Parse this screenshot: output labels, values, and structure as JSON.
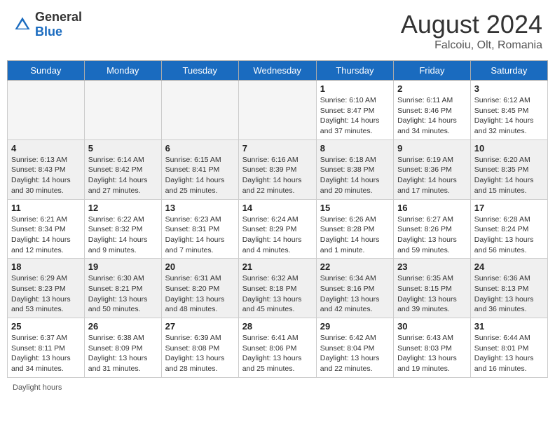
{
  "header": {
    "logo_general": "General",
    "logo_blue": "Blue",
    "month_year": "August 2024",
    "location": "Falcoiu, Olt, Romania"
  },
  "days_of_week": [
    "Sunday",
    "Monday",
    "Tuesday",
    "Wednesday",
    "Thursday",
    "Friday",
    "Saturday"
  ],
  "footer_text": "Daylight hours",
  "weeks": [
    [
      {
        "day": "",
        "empty": true
      },
      {
        "day": "",
        "empty": true
      },
      {
        "day": "",
        "empty": true
      },
      {
        "day": "",
        "empty": true
      },
      {
        "day": "1",
        "sunrise": "6:10 AM",
        "sunset": "8:47 PM",
        "daylight": "14 hours and 37 minutes."
      },
      {
        "day": "2",
        "sunrise": "6:11 AM",
        "sunset": "8:46 PM",
        "daylight": "14 hours and 34 minutes."
      },
      {
        "day": "3",
        "sunrise": "6:12 AM",
        "sunset": "8:45 PM",
        "daylight": "14 hours and 32 minutes."
      }
    ],
    [
      {
        "day": "4",
        "sunrise": "6:13 AM",
        "sunset": "8:43 PM",
        "daylight": "14 hours and 30 minutes."
      },
      {
        "day": "5",
        "sunrise": "6:14 AM",
        "sunset": "8:42 PM",
        "daylight": "14 hours and 27 minutes."
      },
      {
        "day": "6",
        "sunrise": "6:15 AM",
        "sunset": "8:41 PM",
        "daylight": "14 hours and 25 minutes."
      },
      {
        "day": "7",
        "sunrise": "6:16 AM",
        "sunset": "8:39 PM",
        "daylight": "14 hours and 22 minutes."
      },
      {
        "day": "8",
        "sunrise": "6:18 AM",
        "sunset": "8:38 PM",
        "daylight": "14 hours and 20 minutes."
      },
      {
        "day": "9",
        "sunrise": "6:19 AM",
        "sunset": "8:36 PM",
        "daylight": "14 hours and 17 minutes."
      },
      {
        "day": "10",
        "sunrise": "6:20 AM",
        "sunset": "8:35 PM",
        "daylight": "14 hours and 15 minutes."
      }
    ],
    [
      {
        "day": "11",
        "sunrise": "6:21 AM",
        "sunset": "8:34 PM",
        "daylight": "14 hours and 12 minutes."
      },
      {
        "day": "12",
        "sunrise": "6:22 AM",
        "sunset": "8:32 PM",
        "daylight": "14 hours and 9 minutes."
      },
      {
        "day": "13",
        "sunrise": "6:23 AM",
        "sunset": "8:31 PM",
        "daylight": "14 hours and 7 minutes."
      },
      {
        "day": "14",
        "sunrise": "6:24 AM",
        "sunset": "8:29 PM",
        "daylight": "14 hours and 4 minutes."
      },
      {
        "day": "15",
        "sunrise": "6:26 AM",
        "sunset": "8:28 PM",
        "daylight": "14 hours and 1 minute."
      },
      {
        "day": "16",
        "sunrise": "6:27 AM",
        "sunset": "8:26 PM",
        "daylight": "13 hours and 59 minutes."
      },
      {
        "day": "17",
        "sunrise": "6:28 AM",
        "sunset": "8:24 PM",
        "daylight": "13 hours and 56 minutes."
      }
    ],
    [
      {
        "day": "18",
        "sunrise": "6:29 AM",
        "sunset": "8:23 PM",
        "daylight": "13 hours and 53 minutes."
      },
      {
        "day": "19",
        "sunrise": "6:30 AM",
        "sunset": "8:21 PM",
        "daylight": "13 hours and 50 minutes."
      },
      {
        "day": "20",
        "sunrise": "6:31 AM",
        "sunset": "8:20 PM",
        "daylight": "13 hours and 48 minutes."
      },
      {
        "day": "21",
        "sunrise": "6:32 AM",
        "sunset": "8:18 PM",
        "daylight": "13 hours and 45 minutes."
      },
      {
        "day": "22",
        "sunrise": "6:34 AM",
        "sunset": "8:16 PM",
        "daylight": "13 hours and 42 minutes."
      },
      {
        "day": "23",
        "sunrise": "6:35 AM",
        "sunset": "8:15 PM",
        "daylight": "13 hours and 39 minutes."
      },
      {
        "day": "24",
        "sunrise": "6:36 AM",
        "sunset": "8:13 PM",
        "daylight": "13 hours and 36 minutes."
      }
    ],
    [
      {
        "day": "25",
        "sunrise": "6:37 AM",
        "sunset": "8:11 PM",
        "daylight": "13 hours and 34 minutes."
      },
      {
        "day": "26",
        "sunrise": "6:38 AM",
        "sunset": "8:09 PM",
        "daylight": "13 hours and 31 minutes."
      },
      {
        "day": "27",
        "sunrise": "6:39 AM",
        "sunset": "8:08 PM",
        "daylight": "13 hours and 28 minutes."
      },
      {
        "day": "28",
        "sunrise": "6:41 AM",
        "sunset": "8:06 PM",
        "daylight": "13 hours and 25 minutes."
      },
      {
        "day": "29",
        "sunrise": "6:42 AM",
        "sunset": "8:04 PM",
        "daylight": "13 hours and 22 minutes."
      },
      {
        "day": "30",
        "sunrise": "6:43 AM",
        "sunset": "8:03 PM",
        "daylight": "13 hours and 19 minutes."
      },
      {
        "day": "31",
        "sunrise": "6:44 AM",
        "sunset": "8:01 PM",
        "daylight": "13 hours and 16 minutes."
      }
    ]
  ]
}
